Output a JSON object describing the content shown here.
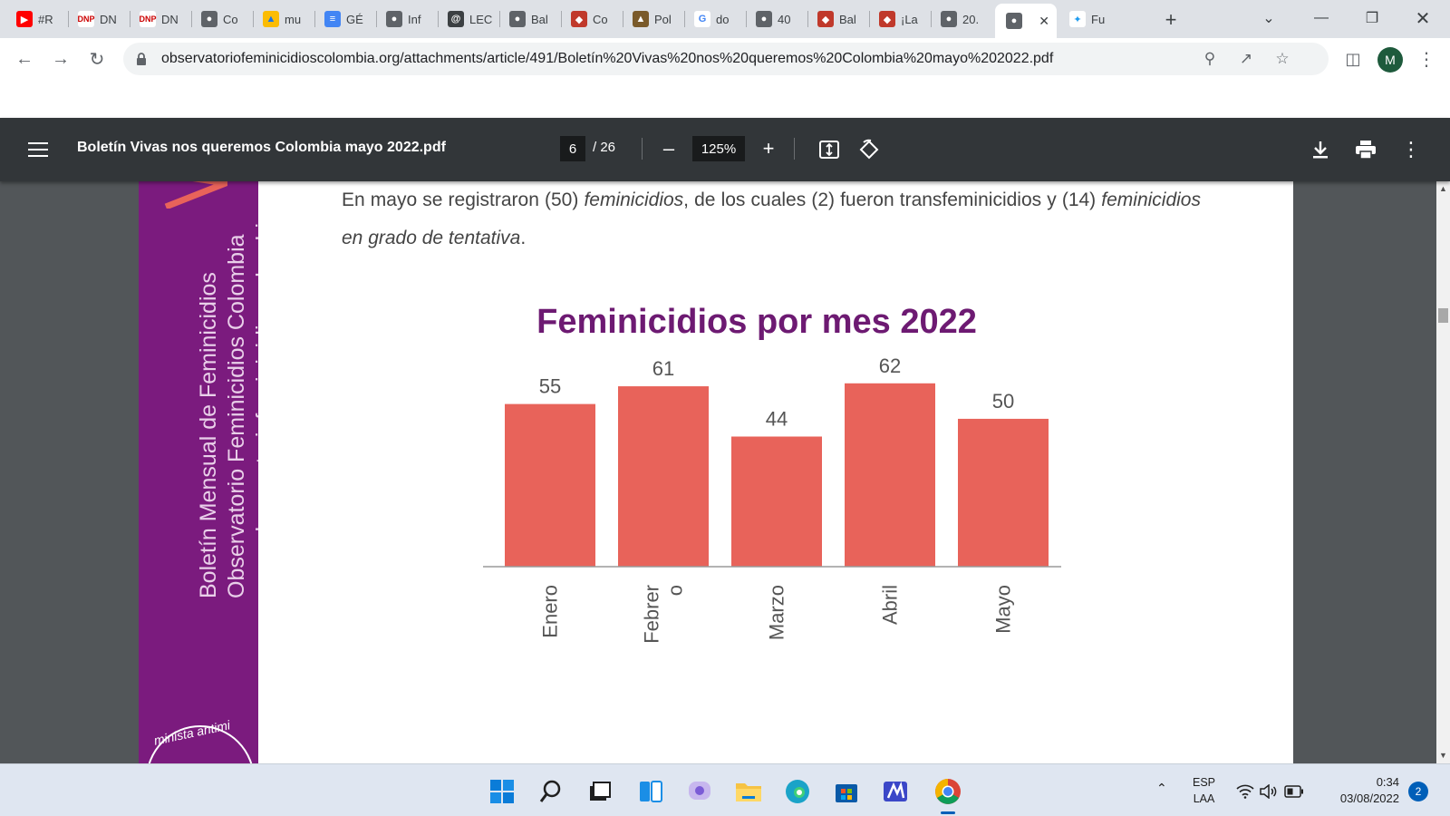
{
  "browser": {
    "tabs": [
      {
        "label": "#R",
        "icon": "youtube-icon"
      },
      {
        "label": "DN",
        "icon": "dnp-icon"
      },
      {
        "label": "DN",
        "icon": "dnp-icon"
      },
      {
        "label": "Co",
        "icon": "globe-icon"
      },
      {
        "label": "mu",
        "icon": "google-drive-icon"
      },
      {
        "label": "GÉ",
        "icon": "google-docs-icon"
      },
      {
        "label": "Inf",
        "icon": "globe-icon"
      },
      {
        "label": "LEC",
        "icon": "lec-icon"
      },
      {
        "label": "Bal",
        "icon": "globe-icon"
      },
      {
        "label": "Co",
        "icon": "site-icon"
      },
      {
        "label": "Pol",
        "icon": "shield-icon"
      },
      {
        "label": "do",
        "icon": "google-icon"
      },
      {
        "label": "40",
        "icon": "globe-icon"
      },
      {
        "label": "Bal",
        "icon": "site-icon"
      },
      {
        "label": "¡La",
        "icon": "site-icon"
      },
      {
        "label": "20.",
        "icon": "globe-icon"
      },
      {
        "label": "",
        "icon": "globe-icon",
        "active": true
      },
      {
        "label": "Fu",
        "icon": "twitter-icon"
      }
    ],
    "url": "observatoriofeminicidioscolombia.org/attachments/article/491/Boletín%20Vivas%20nos%20queremos%20Colombia%20mayo%202022.pdf",
    "avatar_letter": "M"
  },
  "pdf": {
    "title": "Boletín Vivas nos queremos Colombia mayo 2022.pdf",
    "page_current": "6",
    "page_total": "/ 26",
    "zoom": "125%"
  },
  "document": {
    "sidebar_lines": [
      "Boletín Mensual de Feminicidios",
      "Observatorio Feminicidios Colombia",
      "www.observatoriofeminicidioscolombia.org"
    ],
    "seal_text": "minista antimi",
    "paragraph": {
      "p1": "En mayo se registraron (50) ",
      "p2": "feminicidios",
      "p3": ", de los cuales (2) fueron transfeminicidios y (14) ",
      "p4": "feminicidios en grado de tentativa",
      "p5": "."
    }
  },
  "chart_data": {
    "type": "bar",
    "title": "Feminicidios por mes 2022",
    "categories": [
      "Enero",
      "Febrero",
      "Marzo",
      "Abril",
      "Mayo"
    ],
    "category_label_lines": [
      [
        "Enero"
      ],
      [
        "Febrer",
        "o"
      ],
      [
        "Marzo"
      ],
      [
        "Abril"
      ],
      [
        "Mayo"
      ]
    ],
    "values": [
      55,
      61,
      44,
      62,
      50
    ],
    "ylim": [
      0,
      65
    ],
    "bar_color": "#e8635a",
    "grid": false,
    "legend": "none"
  },
  "taskbar": {
    "apps": [
      "windows-start-icon",
      "search-icon",
      "task-view-icon",
      "widgets-icon",
      "chat-icon",
      "file-explorer-icon",
      "edge-icon",
      "store-icon",
      "app-icon",
      "chrome-icon"
    ],
    "lang_line1": "ESP",
    "lang_line2": "LAA",
    "time": "0:34",
    "date": "03/08/2022",
    "notifications": "2"
  }
}
